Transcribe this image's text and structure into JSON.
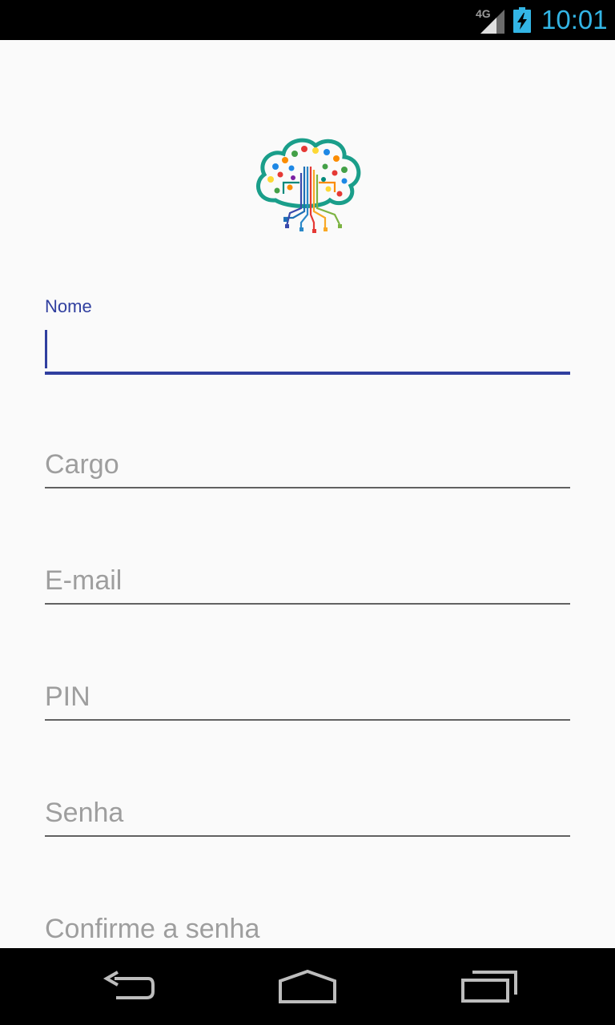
{
  "status_bar": {
    "network_label": "4G",
    "time": "10:01",
    "accent_color": "#33b5e5"
  },
  "form": {
    "logo_icon": "tree-circuit-logo-icon",
    "fields": [
      {
        "label": "Nome",
        "value": "",
        "placeholder": "",
        "focused": true
      },
      {
        "label": "",
        "value": "",
        "placeholder": "Cargo",
        "focused": false
      },
      {
        "label": "",
        "value": "",
        "placeholder": "E-mail",
        "focused": false
      },
      {
        "label": "",
        "value": "",
        "placeholder": "PIN",
        "focused": false
      },
      {
        "label": "",
        "value": "",
        "placeholder": "Senha",
        "focused": false
      },
      {
        "label": "",
        "value": "",
        "placeholder": "Confirme a senha",
        "focused": false
      }
    ],
    "accent_color": "#303f9f"
  },
  "nav_bar": {
    "back_icon": "back-arrow-icon",
    "home_icon": "home-icon",
    "recents_icon": "recents-icon"
  }
}
